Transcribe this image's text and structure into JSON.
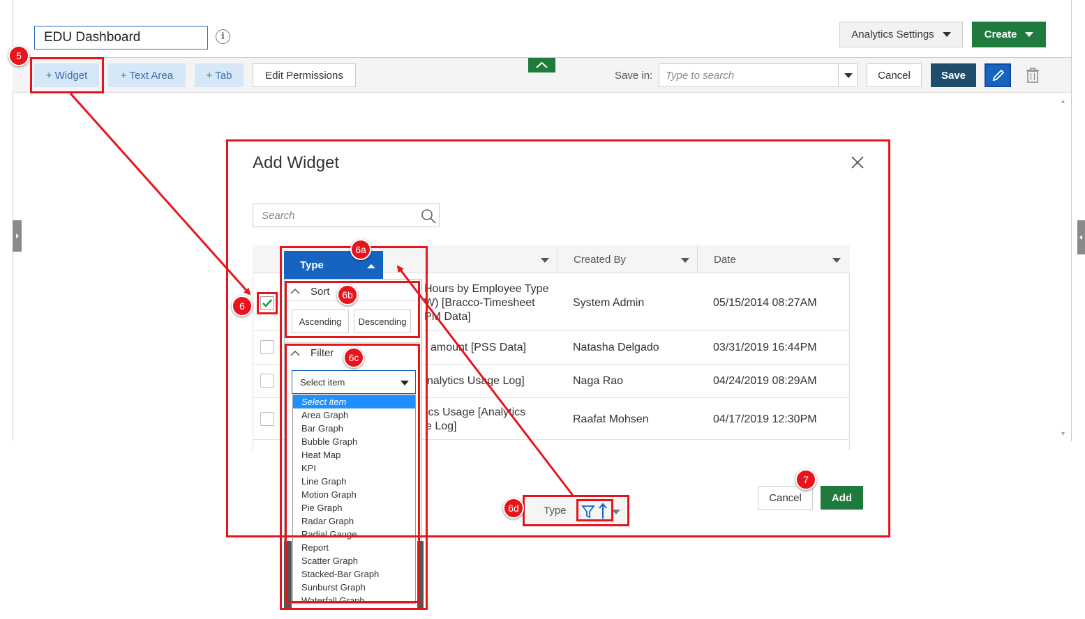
{
  "header": {
    "dashboard_name": "EDU Dashboard",
    "info_icon": "i",
    "analytics_settings_label": "Analytics Settings",
    "create_label": "Create"
  },
  "toolbar": {
    "add_widget_label": "+ Widget",
    "add_text_area_label": "+ Text Area",
    "add_tab_label": "+ Tab",
    "edit_permissions_label": "Edit Permissions",
    "save_in_label": "Save in:",
    "save_in_placeholder": "Type to search",
    "cancel_label": "Cancel",
    "save_label": "Save"
  },
  "dialog": {
    "title": "Add Widget",
    "search_placeholder": "Search",
    "columns": {
      "type": "Type",
      "created_by": "Created By",
      "date": "Date"
    },
    "rows": [
      {
        "name_lines": [
          "Hours by Employee Type",
          "W) [Bracco-Timesheet",
          "PM Data]"
        ],
        "created_by": "System Admin",
        "date": "05/15/2014 08:27AM",
        "checked": true
      },
      {
        "name_lines": [
          "amount [PSS Data]"
        ],
        "created_by": "Natasha Delgado",
        "date": "03/31/2019 16:44PM",
        "checked": false
      },
      {
        "name_lines": [
          "nalytics Usage Log]"
        ],
        "created_by": "Naga Rao",
        "date": "04/24/2019 08:29AM",
        "checked": false
      },
      {
        "name_lines": [
          "ics Usage [Analytics",
          "e Log]"
        ],
        "created_by": "Raafat Mohsen",
        "date": "04/17/2019 12:30PM",
        "checked": false
      }
    ],
    "column_menu": {
      "sort_title": "Sort",
      "ascending_label": "Ascending",
      "descending_label": "Descending",
      "filter_title": "Filter",
      "select_placeholder": "Select item",
      "filter_options": [
        "Select item",
        "Area Graph",
        "Bar Graph",
        "Bubble Graph",
        "Heat Map",
        "KPI",
        "Line Graph",
        "Motion Graph",
        "Pie Graph",
        "Radar Graph",
        "Radial Gauge",
        "Report",
        "Scatter Graph",
        "Stacked-Bar Graph",
        "Sunburst Graph",
        "Waterfall Graph"
      ],
      "selected_option": "Select item"
    },
    "footer": {
      "type_label": "Type",
      "cancel_label": "Cancel",
      "add_label": "Add"
    }
  },
  "annotations": {
    "step_5": "5",
    "step_6": "6",
    "step_6a": "6a",
    "step_6b": "6b",
    "step_6c": "6c",
    "step_6d": "6d",
    "step_7": "7",
    "color": "#e8141c"
  },
  "colors": {
    "primary_green": "#1f7a3d",
    "primary_blue": "#1565c0",
    "navy": "#1e4c6b",
    "light_blue": "#d6e7f7"
  }
}
